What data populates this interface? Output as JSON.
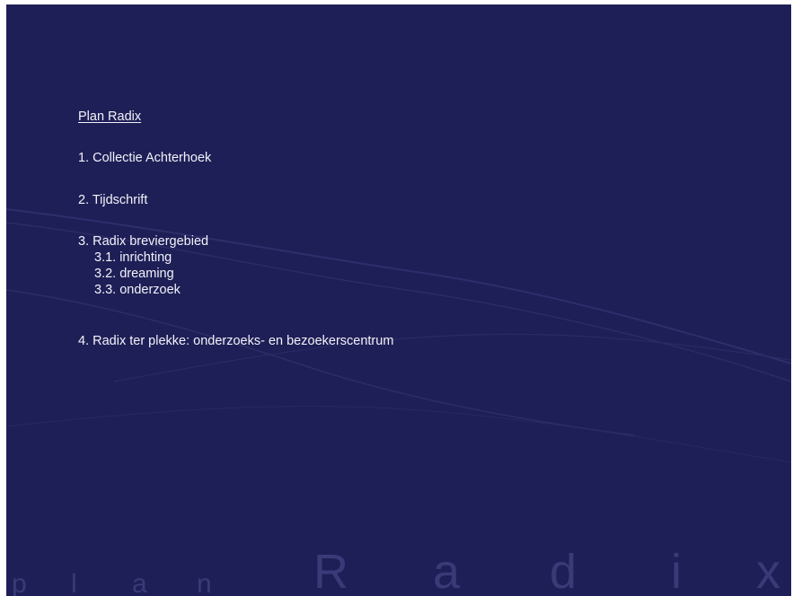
{
  "slide": {
    "title": "Plan Radix",
    "items": [
      "1. Collectie Achterhoek",
      "2. Tijdschrift",
      "3. Radix breviergebied",
      "4. Radix ter plekke: onderzoeks- en bezoekerscentrum"
    ],
    "subitems": [
      "3.1. inrichting",
      "3.2. dreaming",
      "3.3. onderzoek"
    ]
  },
  "watermark": {
    "letters": [
      "p",
      "l",
      "a",
      "n",
      "R",
      "a",
      "d",
      "i",
      "x"
    ]
  },
  "colors": {
    "background": "#1f1f57",
    "text": "#f2f2fa",
    "watermark": "#3a3a78"
  }
}
